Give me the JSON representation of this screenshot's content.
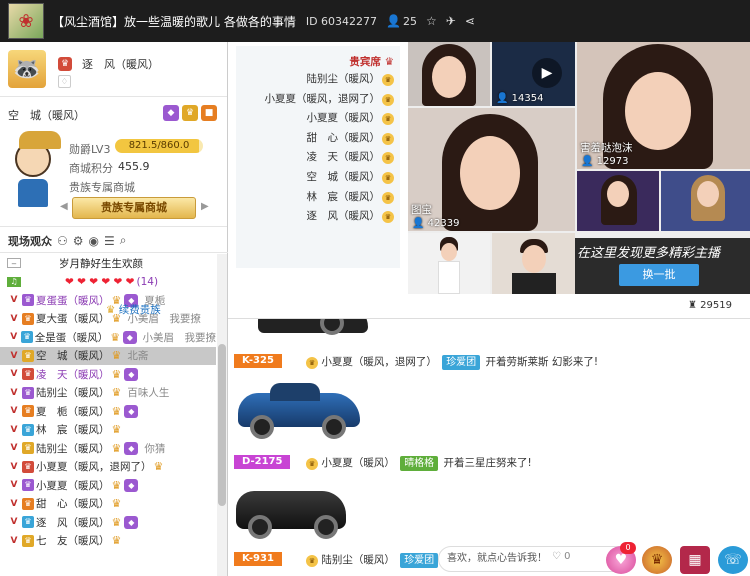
{
  "topbar": {
    "room_title": "【风尘酒馆】放一些温暖的歌儿 各做各的事情",
    "room_id": "ID 60342277",
    "fans": "25"
  },
  "user_card": {
    "name": "逐　风（暖风）"
  },
  "user2": {
    "name": "空　城（暖风）",
    "rank_label": "勋爵LV3",
    "rank_progress": "821.5/860.0",
    "rank_fraction": 0.955,
    "mall_label": "商城积分",
    "mall_value": "455.9",
    "noble_label": "贵族专属商城",
    "noble_button": "贵族专属商城"
  },
  "audience": {
    "title": "现场观众"
  },
  "list": [
    {
      "name": "岁月静好生生欢颜",
      "tail": "",
      "style": "header"
    },
    {
      "name": "❤ ❤ ❤ ❤ ❤ ❤",
      "tail": "(14)",
      "style": "hearts"
    },
    {
      "name": "夏蛋蛋（暖风）",
      "tail": "夏栀",
      "style": "purple"
    },
    {
      "name": "夏大蛋（暖风）",
      "tail": "小美眉　我要撩",
      "style": "normal"
    },
    {
      "name": "全是蛋（暖风）",
      "tail": "小美眉　我要撩",
      "style": "normal"
    },
    {
      "name": "空　城（暖风）",
      "tail": "北斋",
      "style": "selected"
    },
    {
      "name": "凌　天（暖风）",
      "tail": "",
      "style": "purple"
    },
    {
      "name": "陆别尘（暖风）",
      "tail": "百味人生",
      "style": "normal"
    },
    {
      "name": "夏　栀（暖风）",
      "tail": "",
      "style": "normal"
    },
    {
      "name": "林　宸（暖风）",
      "tail": "",
      "style": "normal"
    },
    {
      "name": "陆别尘（暖风）",
      "tail": "你猜",
      "style": "normal"
    },
    {
      "name": "小夏夏（暖风，退网了）",
      "tail": "",
      "style": "normal"
    },
    {
      "name": "小夏夏（暖风）",
      "tail": "",
      "style": "normal"
    },
    {
      "name": "甜　心（暖风）",
      "tail": "",
      "style": "normal"
    },
    {
      "name": "逐　风（暖风）",
      "tail": "",
      "style": "normal"
    },
    {
      "name": "七　友（暖风）",
      "tail": "",
      "style": "normal"
    }
  ],
  "vip": {
    "title": "贵宾席",
    "rows": [
      "陆别尘（暖风）",
      "小夏夏（暖风，退网了）",
      "小夏夏（暖风）",
      "甜　心（暖风）",
      "凌　天（暖风）",
      "空　城（暖风）",
      "林　宸（暖风）",
      "逐　风（暖风）"
    ],
    "renew": "续费贵族"
  },
  "grid": {
    "t2_count": "14354",
    "t3_name": "害羞哒泡沫",
    "t3_count": "12973",
    "t4_name": "图宝",
    "t4_count": "42339",
    "discover_text": "在这里发现更多精彩主播",
    "refresh": "换一批",
    "viewers": "29519"
  },
  "chat": [
    {
      "plate": "K-325",
      "user": "小夏夏（暖风，退网了）",
      "tag": "珍爱团",
      "text": "开着劳斯莱斯 幻影来了!"
    },
    {
      "plate": "D-2175",
      "user": "小夏夏（暖风）",
      "tag": "晴格格",
      "text": "开着三星庄努来了!"
    },
    {
      "plate": "K-931",
      "user": "陆别尘（暖风）",
      "tag": "珍爱团",
      "text": ""
    }
  ],
  "inputbar": {
    "placeholder": "喜欢，就点心告诉我！",
    "heart_count": "0",
    "badge": "0"
  }
}
